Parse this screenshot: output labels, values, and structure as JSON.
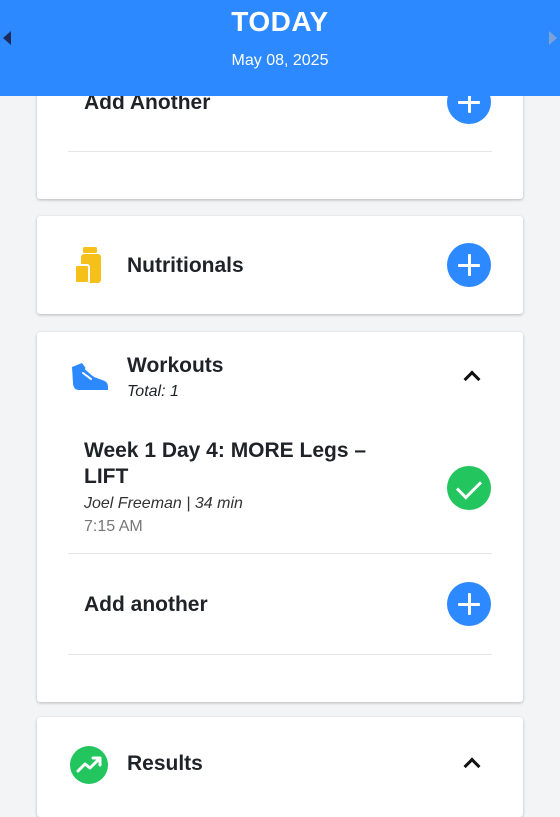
{
  "header": {
    "title": "TODAY",
    "date": "May 08, 2025",
    "prev_icon": "triangle-left-icon",
    "next_icon": "triangle-right-icon",
    "background_color": "#2d89ff"
  },
  "top_card": {
    "add_label": "Add Another"
  },
  "nutritionals": {
    "label": "Nutritionals",
    "icon": "container-icon",
    "icon_color": "#f5c01a"
  },
  "workouts": {
    "label": "Workouts",
    "total": "Total: 1",
    "icon": "sneaker-icon",
    "icon_color": "#2d89ff",
    "item": {
      "title": "Week 1 Day 4: MORE Legs – LIFT",
      "trainer_duration": "Joel Freeman | 34 min",
      "time": "7:15 AM",
      "status_icon": "check-icon",
      "status_color": "#22c55e"
    },
    "add_label": "Add another"
  },
  "results": {
    "label": "Results",
    "icon": "trending-up-icon",
    "icon_color": "#22c55e"
  },
  "colors": {
    "accent": "#2d89ff",
    "success": "#22c55e",
    "background": "#f3f4f6"
  }
}
